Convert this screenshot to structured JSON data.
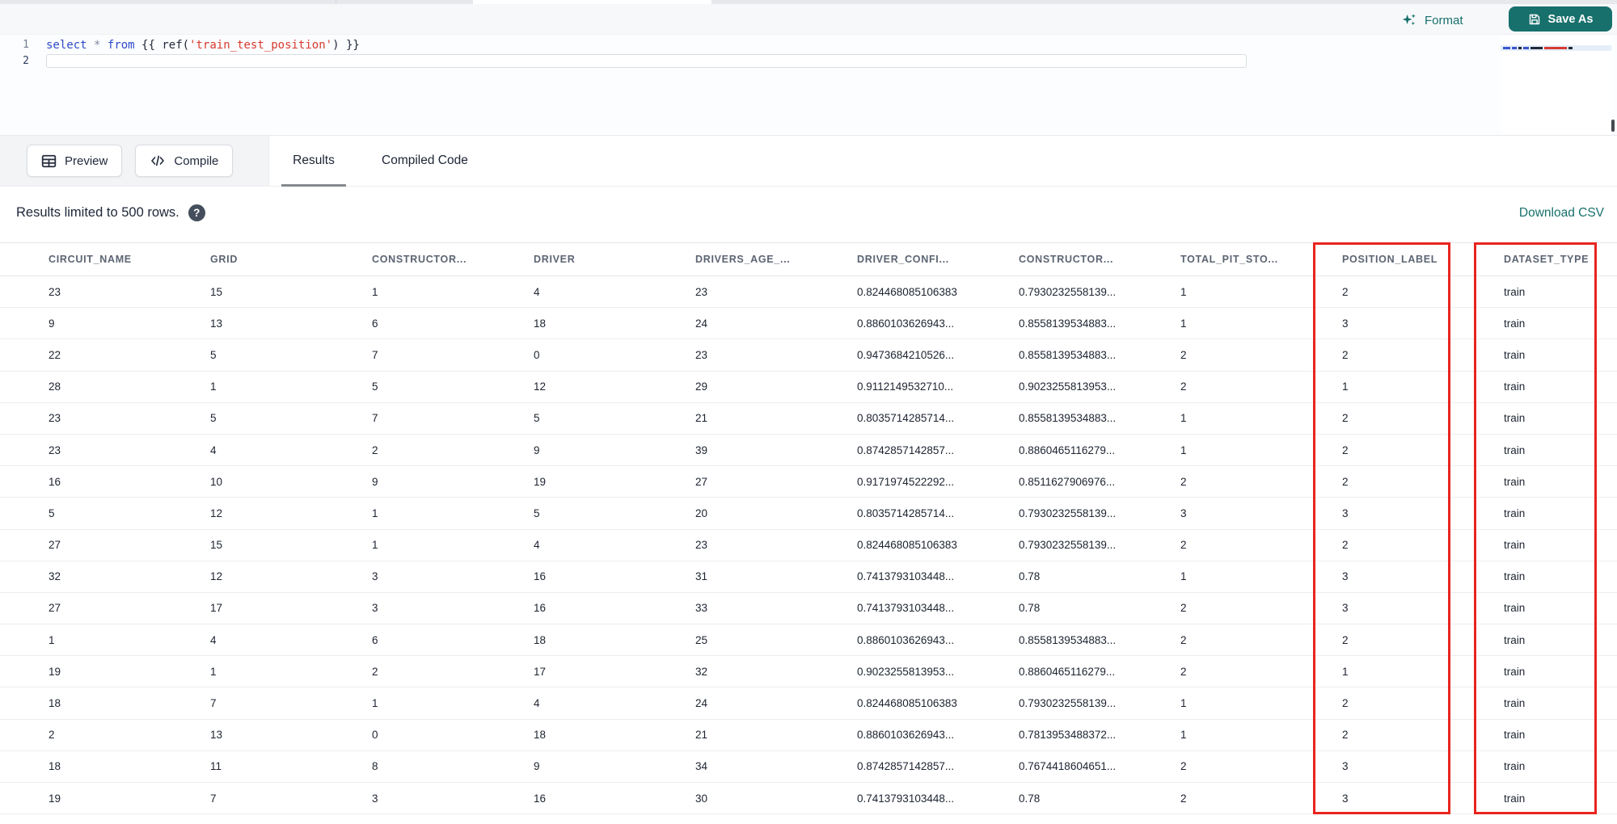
{
  "colors": {
    "accent_teal": "#17706c",
    "annotation_red": "#e8241f",
    "code_keyword_blue": "#2d49c9",
    "code_string_red": "#d8392e"
  },
  "editor": {
    "format_label": "Format",
    "save_as_label": "Save As",
    "line_numbers": [
      "1",
      "2"
    ],
    "code_tokens": [
      {
        "text": "select",
        "cls": "kw"
      },
      {
        "text": " ",
        "cls": "pl"
      },
      {
        "text": "*",
        "cls": "op"
      },
      {
        "text": " ",
        "cls": "pl"
      },
      {
        "text": "from",
        "cls": "kw"
      },
      {
        "text": " ",
        "cls": "pl"
      },
      {
        "text": "{{ ",
        "cls": "br"
      },
      {
        "text": "ref(",
        "cls": "fn"
      },
      {
        "text": "'train_test_position'",
        "cls": "str"
      },
      {
        "text": ")",
        "cls": "fn"
      },
      {
        "text": " ",
        "cls": "pl"
      },
      {
        "text": "}}",
        "cls": "br"
      }
    ]
  },
  "action_bar": {
    "preview_label": "Preview",
    "compile_label": "Compile",
    "tabs": [
      {
        "label": "Results",
        "active": true
      },
      {
        "label": "Compiled Code",
        "active": false
      }
    ]
  },
  "status_bar": {
    "limit_text": "Results limited to 500 rows.",
    "help_icon_glyph": "?",
    "download_csv_label": "Download CSV"
  },
  "results_table": {
    "columns": [
      "CIRCUIT_NAME",
      "GRID",
      "CONSTRUCTOR...",
      "DRIVER",
      "DRIVERS_AGE_...",
      "DRIVER_CONFI...",
      "CONSTRUCTOR...",
      "TOTAL_PIT_STO...",
      "POSITION_LABEL",
      "DATASET_TYPE"
    ],
    "highlighted_columns": [
      "POSITION_LABEL",
      "DATASET_TYPE"
    ],
    "rows": [
      [
        "23",
        "15",
        "1",
        "4",
        "23",
        "0.824468085106383",
        "0.7930232558139...",
        "1",
        "2",
        "train"
      ],
      [
        "9",
        "13",
        "6",
        "18",
        "24",
        "0.8860103626943...",
        "0.8558139534883...",
        "1",
        "3",
        "train"
      ],
      [
        "22",
        "5",
        "7",
        "0",
        "23",
        "0.9473684210526...",
        "0.8558139534883...",
        "2",
        "2",
        "train"
      ],
      [
        "28",
        "1",
        "5",
        "12",
        "29",
        "0.9112149532710...",
        "0.9023255813953...",
        "2",
        "1",
        "train"
      ],
      [
        "23",
        "5",
        "7",
        "5",
        "21",
        "0.8035714285714...",
        "0.8558139534883...",
        "1",
        "2",
        "train"
      ],
      [
        "23",
        "4",
        "2",
        "9",
        "39",
        "0.8742857142857...",
        "0.8860465116279...",
        "1",
        "2",
        "train"
      ],
      [
        "16",
        "10",
        "9",
        "19",
        "27",
        "0.9171974522292...",
        "0.8511627906976...",
        "2",
        "2",
        "train"
      ],
      [
        "5",
        "12",
        "1",
        "5",
        "20",
        "0.8035714285714...",
        "0.7930232558139...",
        "3",
        "3",
        "train"
      ],
      [
        "27",
        "15",
        "1",
        "4",
        "23",
        "0.824468085106383",
        "0.7930232558139...",
        "2",
        "2",
        "train"
      ],
      [
        "32",
        "12",
        "3",
        "16",
        "31",
        "0.7413793103448...",
        "0.78",
        "1",
        "3",
        "train"
      ],
      [
        "27",
        "17",
        "3",
        "16",
        "33",
        "0.7413793103448...",
        "0.78",
        "2",
        "3",
        "train"
      ],
      [
        "1",
        "4",
        "6",
        "18",
        "25",
        "0.8860103626943...",
        "0.8558139534883...",
        "2",
        "2",
        "train"
      ],
      [
        "19",
        "1",
        "2",
        "17",
        "32",
        "0.9023255813953...",
        "0.8860465116279...",
        "2",
        "1",
        "train"
      ],
      [
        "18",
        "7",
        "1",
        "4",
        "24",
        "0.824468085106383",
        "0.7930232558139...",
        "1",
        "2",
        "train"
      ],
      [
        "2",
        "13",
        "0",
        "18",
        "21",
        "0.8860103626943...",
        "0.7813953488372...",
        "1",
        "2",
        "train"
      ],
      [
        "18",
        "11",
        "8",
        "9",
        "34",
        "0.8742857142857...",
        "0.7674418604651...",
        "2",
        "3",
        "train"
      ],
      [
        "19",
        "7",
        "3",
        "16",
        "30",
        "0.7413793103448...",
        "0.78",
        "2",
        "3",
        "train"
      ]
    ]
  }
}
